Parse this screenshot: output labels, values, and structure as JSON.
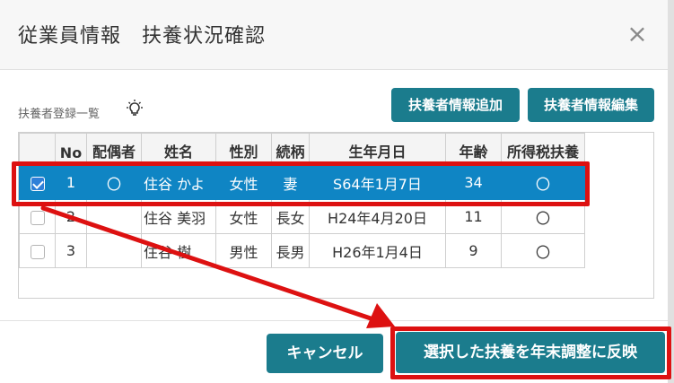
{
  "dialog": {
    "title": "従業員情報　扶養状況確認",
    "close_label": "×"
  },
  "list": {
    "label": "扶養者登録一覧"
  },
  "buttons": {
    "add": "扶養者情報追加",
    "edit": "扶養者情報編集",
    "cancel": "キャンセル",
    "apply": "選択した扶養を年末調整に反映"
  },
  "table": {
    "headers": [
      "",
      "No",
      "配偶者",
      "姓名",
      "性別",
      "続柄",
      "生年月日",
      "年齢",
      "所得税扶養"
    ],
    "rows": [
      {
        "checked": true,
        "no": "1",
        "spouse": "〇",
        "name": "住谷 かよ",
        "gender": "女性",
        "relation": "妻",
        "birth": "S64年1月7日",
        "age": "34",
        "tax": "〇"
      },
      {
        "checked": false,
        "no": "2",
        "spouse": "",
        "name": "住谷 美羽",
        "gender": "女性",
        "relation": "長女",
        "birth": "H24年4月20日",
        "age": "11",
        "tax": "〇"
      },
      {
        "checked": false,
        "no": "3",
        "spouse": "",
        "name": "住谷 樹",
        "gender": "男性",
        "relation": "長男",
        "birth": "H26年1月4日",
        "age": "9",
        "tax": "〇"
      }
    ]
  },
  "colors": {
    "primary_button": "#1b7c8d",
    "selected_row": "#0f85c4",
    "annotation": "#dd1111"
  },
  "icons": {
    "list_hint": "lightbulb-icon",
    "close": "close-icon"
  }
}
